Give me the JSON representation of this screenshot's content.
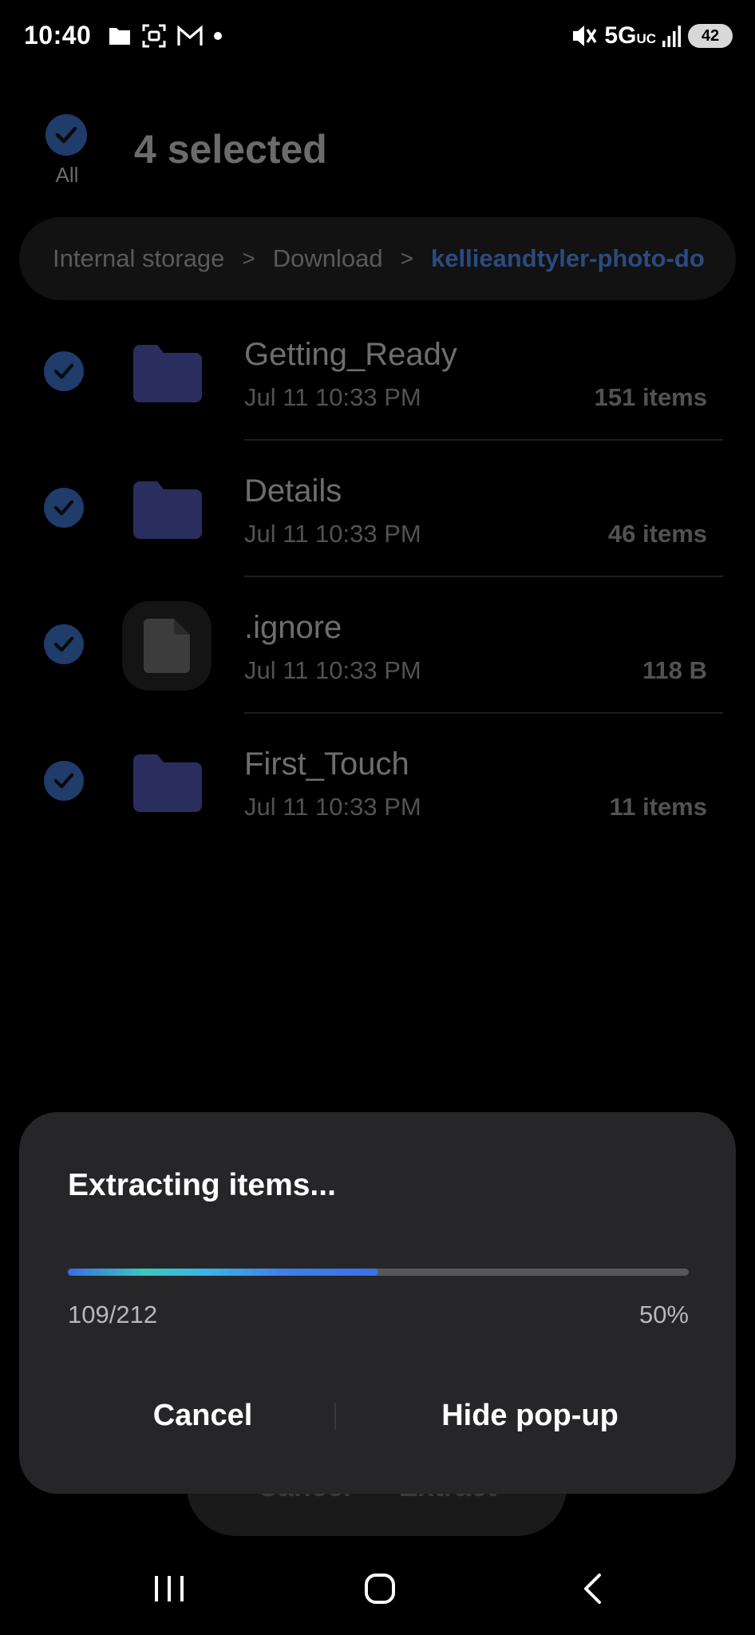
{
  "status_bar": {
    "time": "10:40",
    "left_icons": [
      "folder-icon",
      "screenshot-icon",
      "gmail-icon",
      "notification-dot-icon"
    ],
    "network": "5G",
    "network_suffix": "UC",
    "battery": "42"
  },
  "header": {
    "select_all_label": "All",
    "selected_title": "4 selected"
  },
  "breadcrumb": {
    "items": [
      "Internal storage",
      "Download"
    ],
    "current": "kellieandtyler-photo-do"
  },
  "files": [
    {
      "name": "Getting_Ready",
      "date": "Jul 11 10:33 PM",
      "meta": "151 items",
      "type": "folder",
      "checked": true
    },
    {
      "name": "Details",
      "date": "Jul 11 10:33 PM",
      "meta": "46 items",
      "type": "folder",
      "checked": true
    },
    {
      "name": ".ignore",
      "date": "Jul 11 10:33 PM",
      "meta": "118 B",
      "type": "file",
      "checked": true
    },
    {
      "name": "First_Touch",
      "date": "Jul 11 10:33 PM",
      "meta": "11 items",
      "type": "folder",
      "checked": true
    }
  ],
  "bottom_bar": {
    "cancel_label": "Cancel",
    "extract_label": "Extract"
  },
  "dialog": {
    "title": "Extracting items...",
    "progress_count": "109/212",
    "progress_percent": "50%",
    "progress_fraction": 0.5,
    "cancel_label": "Cancel",
    "hide_label": "Hide pop-up"
  },
  "colors": {
    "accent_blue": "#3b70e4",
    "dialog_bg": "#262628",
    "folder_dim": "#2a2e5e"
  },
  "nav_bar": {
    "icons": [
      "recent-apps-icon",
      "home-icon",
      "back-icon"
    ]
  }
}
